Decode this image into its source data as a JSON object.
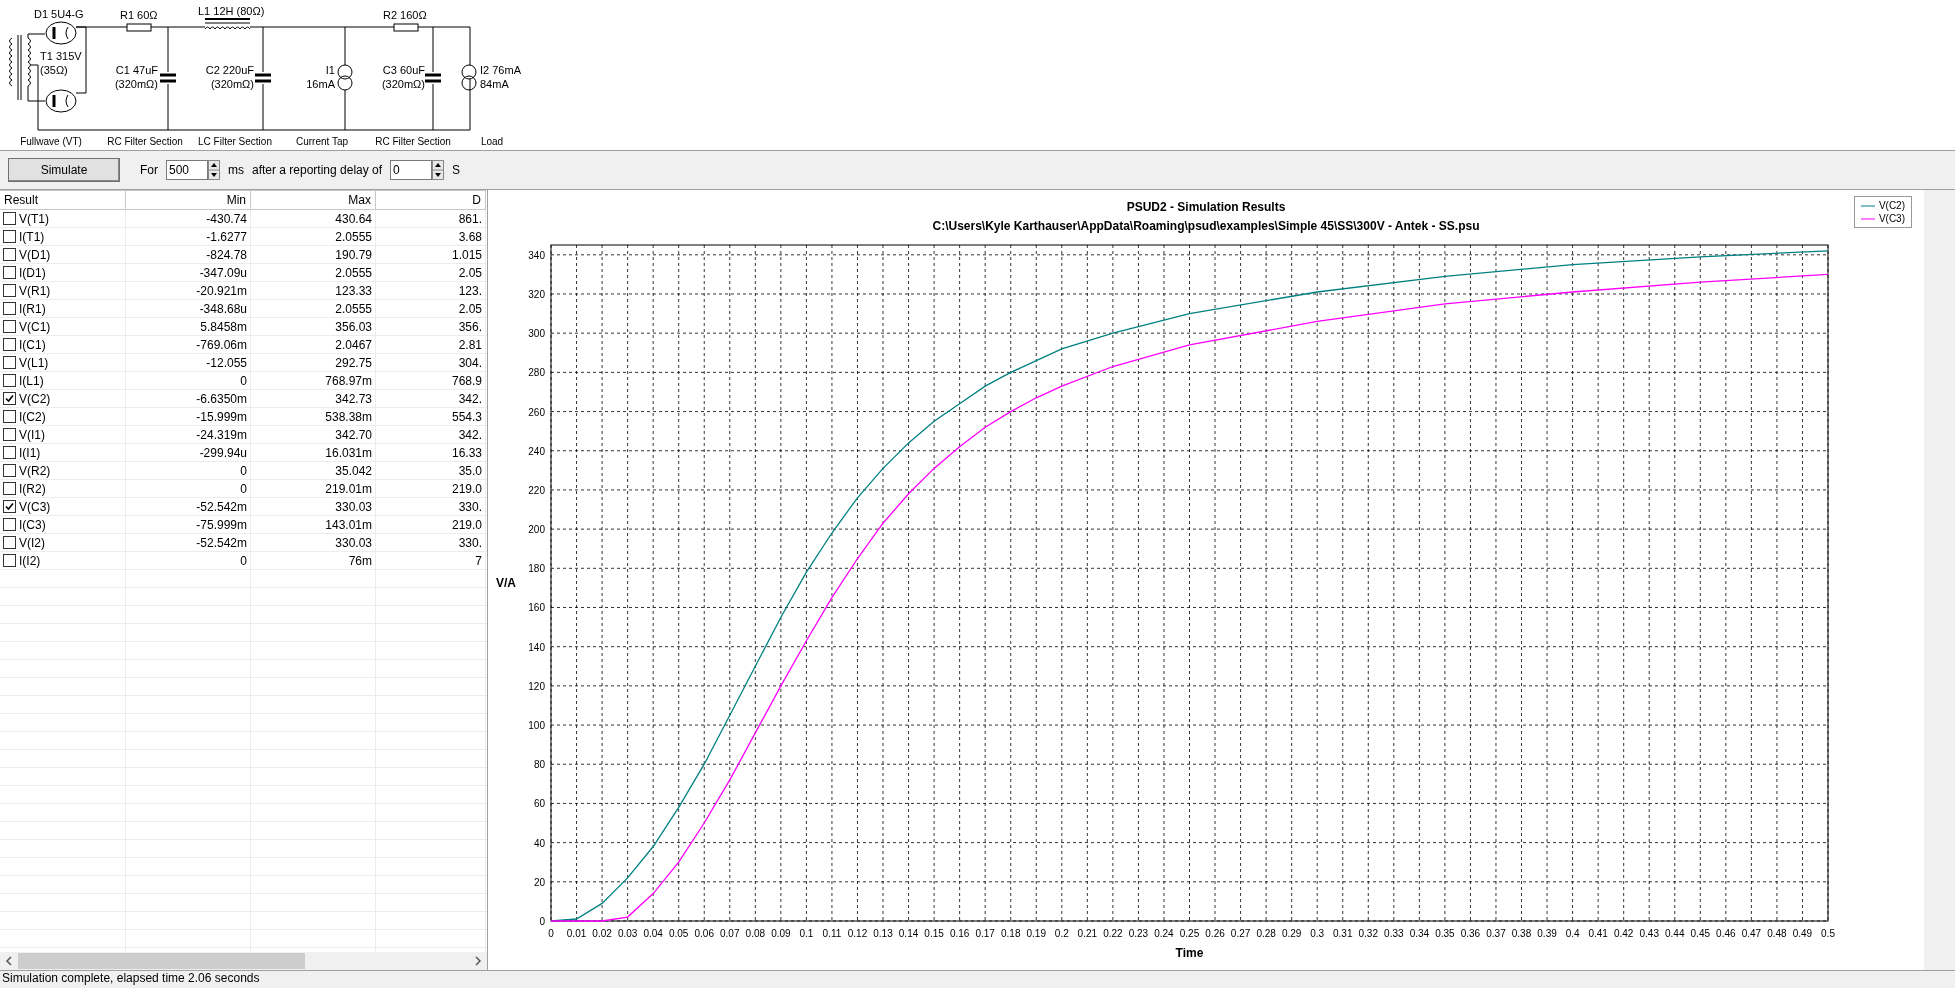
{
  "schematic": {
    "components": [
      {
        "kind": "diodes",
        "labels": [
          "D1 5U4-G"
        ]
      },
      {
        "kind": "transformer",
        "labels": [
          "T1 315V",
          "(35Ω)"
        ]
      },
      {
        "kind": "resistor",
        "labels": [
          "R1 60Ω"
        ]
      },
      {
        "kind": "capacitor",
        "labels": [
          "C1 47uF",
          "(320mΩ)"
        ]
      },
      {
        "kind": "inductor",
        "labels": [
          "L1 12H (80Ω)"
        ]
      },
      {
        "kind": "capacitor",
        "labels": [
          "C2 220uF",
          "(320mΩ)"
        ]
      },
      {
        "kind": "current_source",
        "labels": [
          "I1",
          "16mA"
        ]
      },
      {
        "kind": "resistor",
        "labels": [
          "R2 160Ω"
        ]
      },
      {
        "kind": "capacitor",
        "labels": [
          "C3 60uF",
          "(320mΩ)"
        ]
      },
      {
        "kind": "load",
        "labels": [
          "I2 76mA",
          "84mA"
        ]
      }
    ],
    "sections": [
      "Fullwave (VT)",
      "RC Filter Section",
      "LC Filter Section",
      "Current Tap",
      "RC Filter Section",
      "Load"
    ]
  },
  "controls": {
    "simulate_button": "Simulate",
    "for_label": "For",
    "duration": "500",
    "duration_unit": "ms",
    "delay_label": "after a reporting delay of",
    "delay": "0",
    "delay_unit": "S"
  },
  "table": {
    "columns": [
      "Result",
      "Min",
      "Max",
      "D"
    ],
    "rows": [
      {
        "name": "V(T1)",
        "checked": false,
        "min": "-430.74",
        "max": "430.64",
        "column_4": "861."
      },
      {
        "name": "I(T1)",
        "checked": false,
        "min": "-1.6277",
        "max": "2.0555",
        "column_4": "3.68"
      },
      {
        "name": "V(D1)",
        "checked": false,
        "min": "-824.78",
        "max": "190.79",
        "column_4": "1.015"
      },
      {
        "name": "I(D1)",
        "checked": false,
        "min": "-347.09u",
        "max": "2.0555",
        "column_4": "2.05"
      },
      {
        "name": "V(R1)",
        "checked": false,
        "min": "-20.921m",
        "max": "123.33",
        "column_4": "123."
      },
      {
        "name": "I(R1)",
        "checked": false,
        "min": "-348.68u",
        "max": "2.0555",
        "column_4": "2.05"
      },
      {
        "name": "V(C1)",
        "checked": false,
        "min": "5.8458m",
        "max": "356.03",
        "column_4": "356."
      },
      {
        "name": "I(C1)",
        "checked": false,
        "min": "-769.06m",
        "max": "2.0467",
        "column_4": "2.81"
      },
      {
        "name": "V(L1)",
        "checked": false,
        "min": "-12.055",
        "max": "292.75",
        "column_4": "304."
      },
      {
        "name": "I(L1)",
        "checked": false,
        "min": "0",
        "max": "768.97m",
        "column_4": "768.9"
      },
      {
        "name": "V(C2)",
        "checked": true,
        "min": "-6.6350m",
        "max": "342.73",
        "column_4": "342."
      },
      {
        "name": "I(C2)",
        "checked": false,
        "min": "-15.999m",
        "max": "538.38m",
        "column_4": "554.3"
      },
      {
        "name": "V(I1)",
        "checked": false,
        "min": "-24.319m",
        "max": "342.70",
        "column_4": "342."
      },
      {
        "name": "I(I1)",
        "checked": false,
        "min": "-299.94u",
        "max": "16.031m",
        "column_4": "16.33"
      },
      {
        "name": "V(R2)",
        "checked": false,
        "min": "0",
        "max": "35.042",
        "column_4": "35.0"
      },
      {
        "name": "I(R2)",
        "checked": false,
        "min": "0",
        "max": "219.01m",
        "column_4": "219.0"
      },
      {
        "name": "V(C3)",
        "checked": true,
        "min": "-52.542m",
        "max": "330.03",
        "column_4": "330."
      },
      {
        "name": "I(C3)",
        "checked": false,
        "min": "-75.999m",
        "max": "143.01m",
        "column_4": "219.0"
      },
      {
        "name": "V(I2)",
        "checked": false,
        "min": "-52.542m",
        "max": "330.03",
        "column_4": "330."
      },
      {
        "name": "I(I2)",
        "checked": false,
        "min": "0",
        "max": "76m",
        "column_4": "7"
      }
    ]
  },
  "chart": {
    "title": "PSUD2 - Simulation Results",
    "subtitle": "C:\\Users\\Kyle Karthauser\\AppData\\Roaming\\psud\\examples\\Simple 45\\SS\\300V - Antek - SS.psu",
    "chart_data": {
      "type": "line",
      "xlabel": "Time",
      "ylabel": "V/A",
      "x": [
        0,
        0.01,
        0.02,
        0.03,
        0.04,
        0.05,
        0.06,
        0.07,
        0.08,
        0.09,
        0.1,
        0.11,
        0.12,
        0.13,
        0.14,
        0.15,
        0.16,
        0.17,
        0.18,
        0.19,
        0.2,
        0.22,
        0.25,
        0.3,
        0.35,
        0.4,
        0.45,
        0.5
      ],
      "series": [
        {
          "name": "V(C2)",
          "color": "#008080",
          "values": [
            0,
            1,
            9,
            22,
            38,
            58,
            80,
            105,
            130,
            155,
            178,
            198,
            216,
            231,
            244,
            255,
            264,
            273,
            280,
            286,
            292,
            300,
            310,
            321,
            329,
            335,
            339,
            342
          ]
        },
        {
          "name": "V(C3)",
          "color": "#ff00ff",
          "values": [
            0,
            0,
            0,
            2,
            14,
            30,
            50,
            72,
            96,
            120,
            143,
            165,
            185,
            203,
            218,
            231,
            242,
            252,
            260,
            267,
            273,
            283,
            294,
            306,
            315,
            321,
            326,
            330
          ]
        }
      ],
      "xlim": [
        0,
        0.5
      ],
      "ylim": [
        0,
        345
      ],
      "grid": true,
      "xticks": [
        0,
        0.01,
        0.02,
        0.03,
        0.04,
        0.05,
        0.06,
        0.07,
        0.08,
        0.09,
        0.1,
        0.11,
        0.12,
        0.13,
        0.14,
        0.15,
        0.16,
        0.17,
        0.18,
        0.19,
        0.2,
        0.21,
        0.22,
        0.23,
        0.24,
        0.25,
        0.26,
        0.27,
        0.28,
        0.29,
        0.3,
        0.31,
        0.32,
        0.33,
        0.34,
        0.35,
        0.36,
        0.37,
        0.38,
        0.39,
        0.4,
        0.41,
        0.42,
        0.43,
        0.44,
        0.45,
        0.46,
        0.47,
        0.48,
        0.49,
        0.5
      ],
      "yticks": [
        0,
        20,
        40,
        60,
        80,
        100,
        120,
        140,
        160,
        180,
        200,
        220,
        240,
        260,
        280,
        300,
        320,
        340
      ]
    }
  },
  "status_bar": "Simulation complete, elapsed time 2.06 seconds"
}
